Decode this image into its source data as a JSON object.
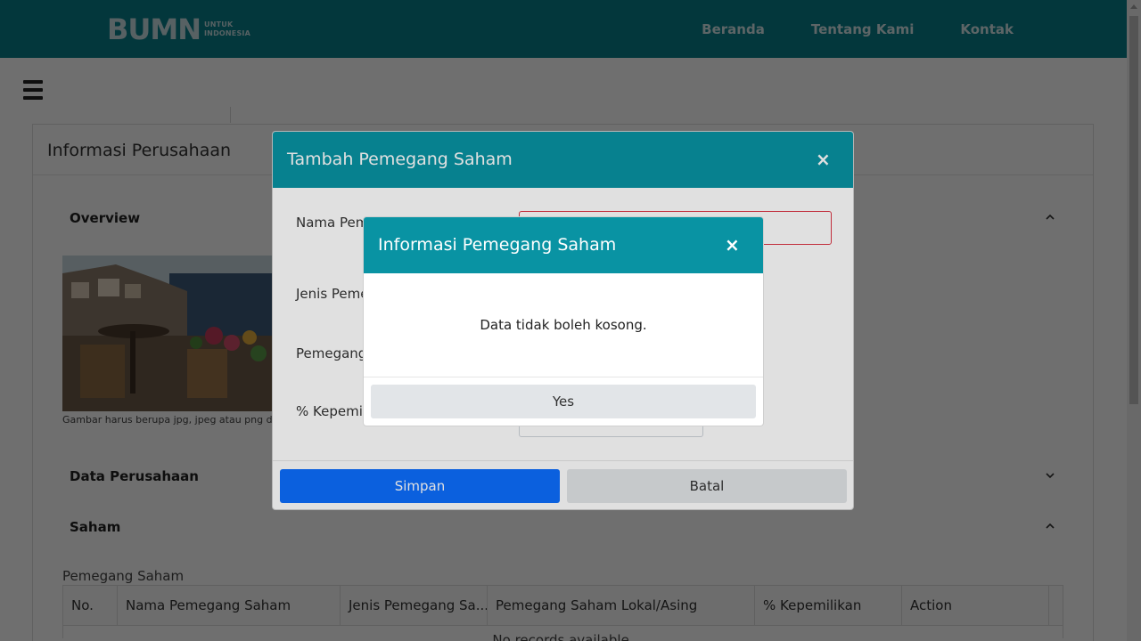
{
  "navbar": {
    "logo_mark": "BUMN",
    "logo_sub_line1": "UNTUK",
    "logo_sub_line2": "INDONESIA",
    "links": [
      "Beranda",
      "Tentang Kami",
      "Kontak"
    ]
  },
  "page": {
    "card_title": "Informasi Perusahaan",
    "sections": {
      "overview": "Overview",
      "data_perusahaan": "Data Perusahaan",
      "saham": "Saham"
    },
    "photo_caption": "Gambar harus berupa jpg, jpeg atau png der",
    "pemegang_saham_label": "Pemegang Saham",
    "table": {
      "headers": [
        "No.",
        "Nama Pemegang Saham",
        "Jenis Pemegang Sa...",
        "Pemegang Saham Lokal/Asing",
        "% Kepemilikan",
        "Action"
      ],
      "empty_text": "No records available."
    }
  },
  "modal_add": {
    "title": "Tambah Pemegang Saham",
    "close": "×",
    "labels": {
      "nama": "Nama Pem",
      "jenis": "Jenis Peme",
      "pemegang": "Pemegang",
      "kepemilikan": "% Kepemil"
    },
    "save_label": "Simpan",
    "cancel_label": "Batal"
  },
  "modal_info": {
    "title": "Informasi Pemegang Saham",
    "close": "×",
    "message": "Data tidak boleh kosong.",
    "yes_label": "Yes"
  },
  "colors": {
    "navbar": "#087e8b",
    "modal_header": "#0993a3",
    "primary": "#0d6efd",
    "secondary": "#e2e5e8",
    "error_border": "#dc3545"
  }
}
